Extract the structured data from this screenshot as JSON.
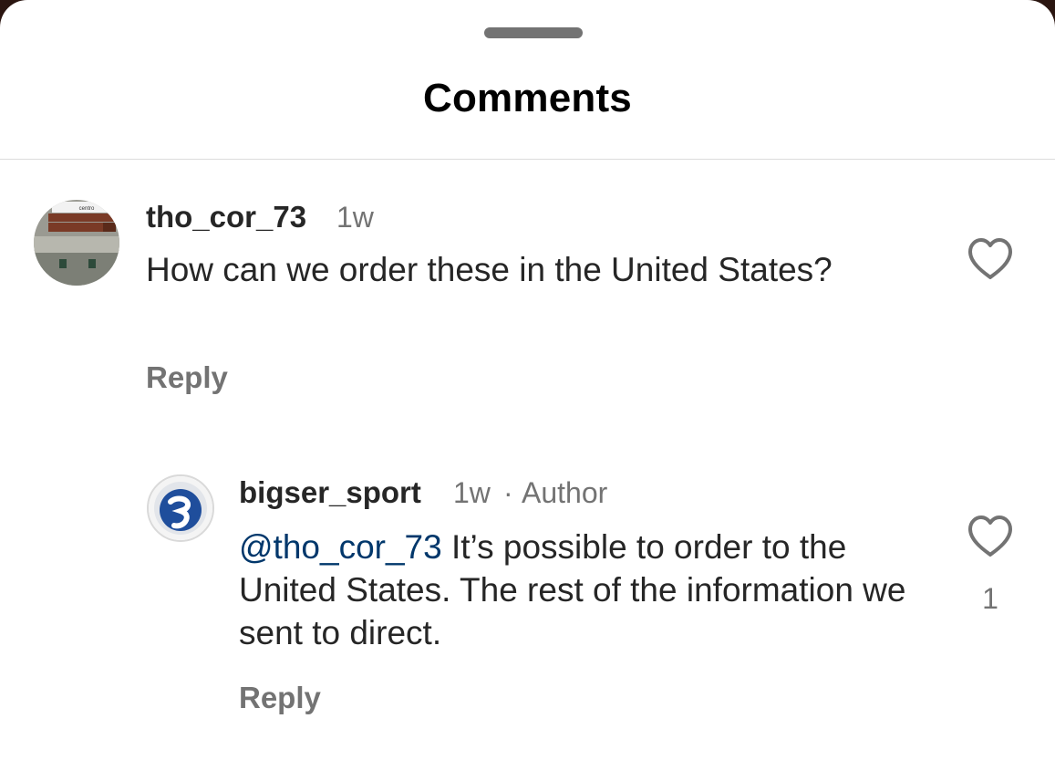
{
  "header": {
    "title": "Comments"
  },
  "comments": [
    {
      "username": "tho_cor_73",
      "time": "1w",
      "text": "How can we order these in the United States?",
      "reply_label": "Reply",
      "avatar_icon": "street-sign-photo",
      "sign_text": "centro"
    },
    {
      "username": "bigser_sport",
      "time": "1w",
      "separator": "·",
      "badge": "Author",
      "mention": "@tho_cor_73",
      "text": " It’s possible to order to the United States. The rest of the information we sent to direct.",
      "reply_label": "Reply",
      "like_count": "1",
      "avatar_icon": "brand-logo",
      "brand_color": "#1f4e9c"
    }
  ],
  "icons": {
    "like": "heart-outline-icon",
    "grabber": "drag-handle-icon"
  }
}
